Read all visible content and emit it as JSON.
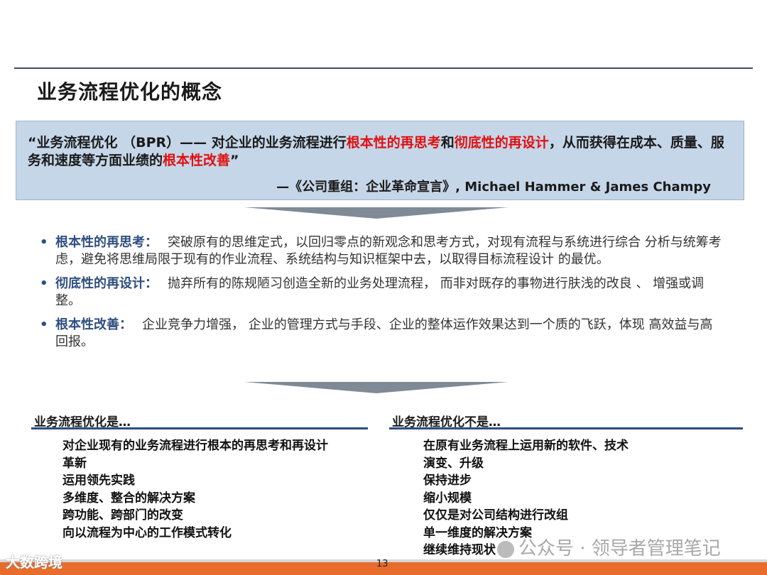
{
  "title": "业务流程优化的概念",
  "quote": {
    "p1": "“业务流程优化 （BPR）—— 对企业的业务流程进行",
    "red1": "根本性的再思考",
    "p2": "和",
    "red2": "彻底性的再设计",
    "p3": "，从而获得在成本、质量、服务和速度等方面业绩的",
    "red3": "根本性改善",
    "p4": "”",
    "source": "—《公司重组：企业革命宣言》, Michael Hammer & James Champy"
  },
  "bullets": [
    {
      "term": "根本性的再思考：",
      "text": "突破原有的思维定式，以回归零点的新观念和思考方式，对现有流程与系统进行综合 分析与统筹考虑，避免将思维局限于现有的作业流程、系统结构与知识框架中去，以取得目标流程设计 的最优。"
    },
    {
      "term": "彻底性的再设计：",
      "text": "抛弃所有的陈规陋习创造全新的业务处理流程，  而非对既存的事物进行肤浅的改良 、 增强或调整。"
    },
    {
      "term": "根本性改善：",
      "text": "企业竞争力增强，  企业的管理方式与手段、企业的整体运作效果达到一个质的飞跃，体现 高效益与高回报。"
    }
  ],
  "is_col": {
    "heading": "业务流程优化是…",
    "items": [
      "对企业现有的业务流程进行根本的再思考和再设计",
      "革新",
      "运用领先实践",
      "多维度、整合的解决方案",
      "跨功能、跨部门的改变",
      "向以流程为中心的工作模式转化"
    ]
  },
  "not_col": {
    "heading": "业务流程优化不是…",
    "items": [
      "在原有业务流程上运用新的软件、技术",
      "演变、升级",
      "保持进步",
      "缩小规模",
      "仅仅是对公司结构进行改组",
      "单一维度的解决方案",
      "继续维持现状"
    ]
  },
  "watermark_right": "公众号 · 领导者管理笔记",
  "watermark_left": "大数跨境",
  "page_number": "13",
  "colors": {
    "accent": "#2b4f80",
    "highlight": "#e01010",
    "box": "#c5d6e8",
    "footer": "#e86c2c"
  }
}
